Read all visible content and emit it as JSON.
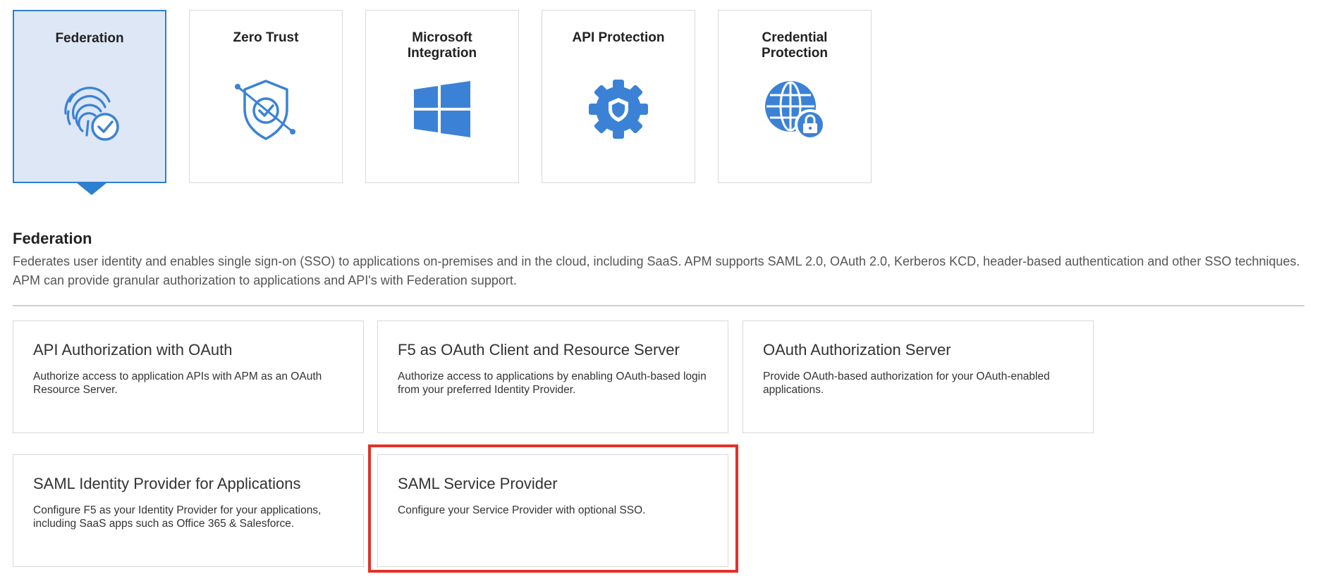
{
  "categories": [
    {
      "label": "Federation",
      "icon": "fingerprint-check-icon",
      "selected": true
    },
    {
      "label": "Zero Trust",
      "icon": "shield-check-icon",
      "selected": false
    },
    {
      "label": "Microsoft\nIntegration",
      "icon": "windows-logo-icon",
      "selected": false
    },
    {
      "label": "API Protection",
      "icon": "gear-shield-icon",
      "selected": false
    },
    {
      "label": "Credential\nProtection",
      "icon": "globe-lock-icon",
      "selected": false
    }
  ],
  "section": {
    "title": "Federation",
    "description": "Federates user identity and enables single sign-on (SSO) to applications on-premises and in the cloud, including SaaS. APM supports SAML 2.0, OAuth 2.0, Kerberos KCD, header-based authentication and other SSO techniques. APM can provide granular authorization to applications and API's with Federation support."
  },
  "options": [
    {
      "title": "API Authorization with OAuth",
      "description": "Authorize access to application APIs with APM as an OAuth Resource Server."
    },
    {
      "title": "F5 as OAuth Client and Resource Server",
      "description": "Authorize access to applications by enabling OAuth-based login from your preferred Identity Provider."
    },
    {
      "title": "OAuth Authorization Server",
      "description": "Provide OAuth-based authorization for your OAuth-enabled applications."
    },
    {
      "title": "SAML Identity Provider for Applications",
      "description": "Configure F5 as your Identity Provider for your applications, including SaaS apps such as Office 365 & Salesforce."
    },
    {
      "title": "SAML Service Provider",
      "description": "Configure your Service Provider with optional SSO."
    }
  ],
  "colors": {
    "accent": "#2d7fd1",
    "icon_blue": "#3b82d6",
    "selected_bg": "#dde7f6",
    "highlight": "#e33128"
  }
}
